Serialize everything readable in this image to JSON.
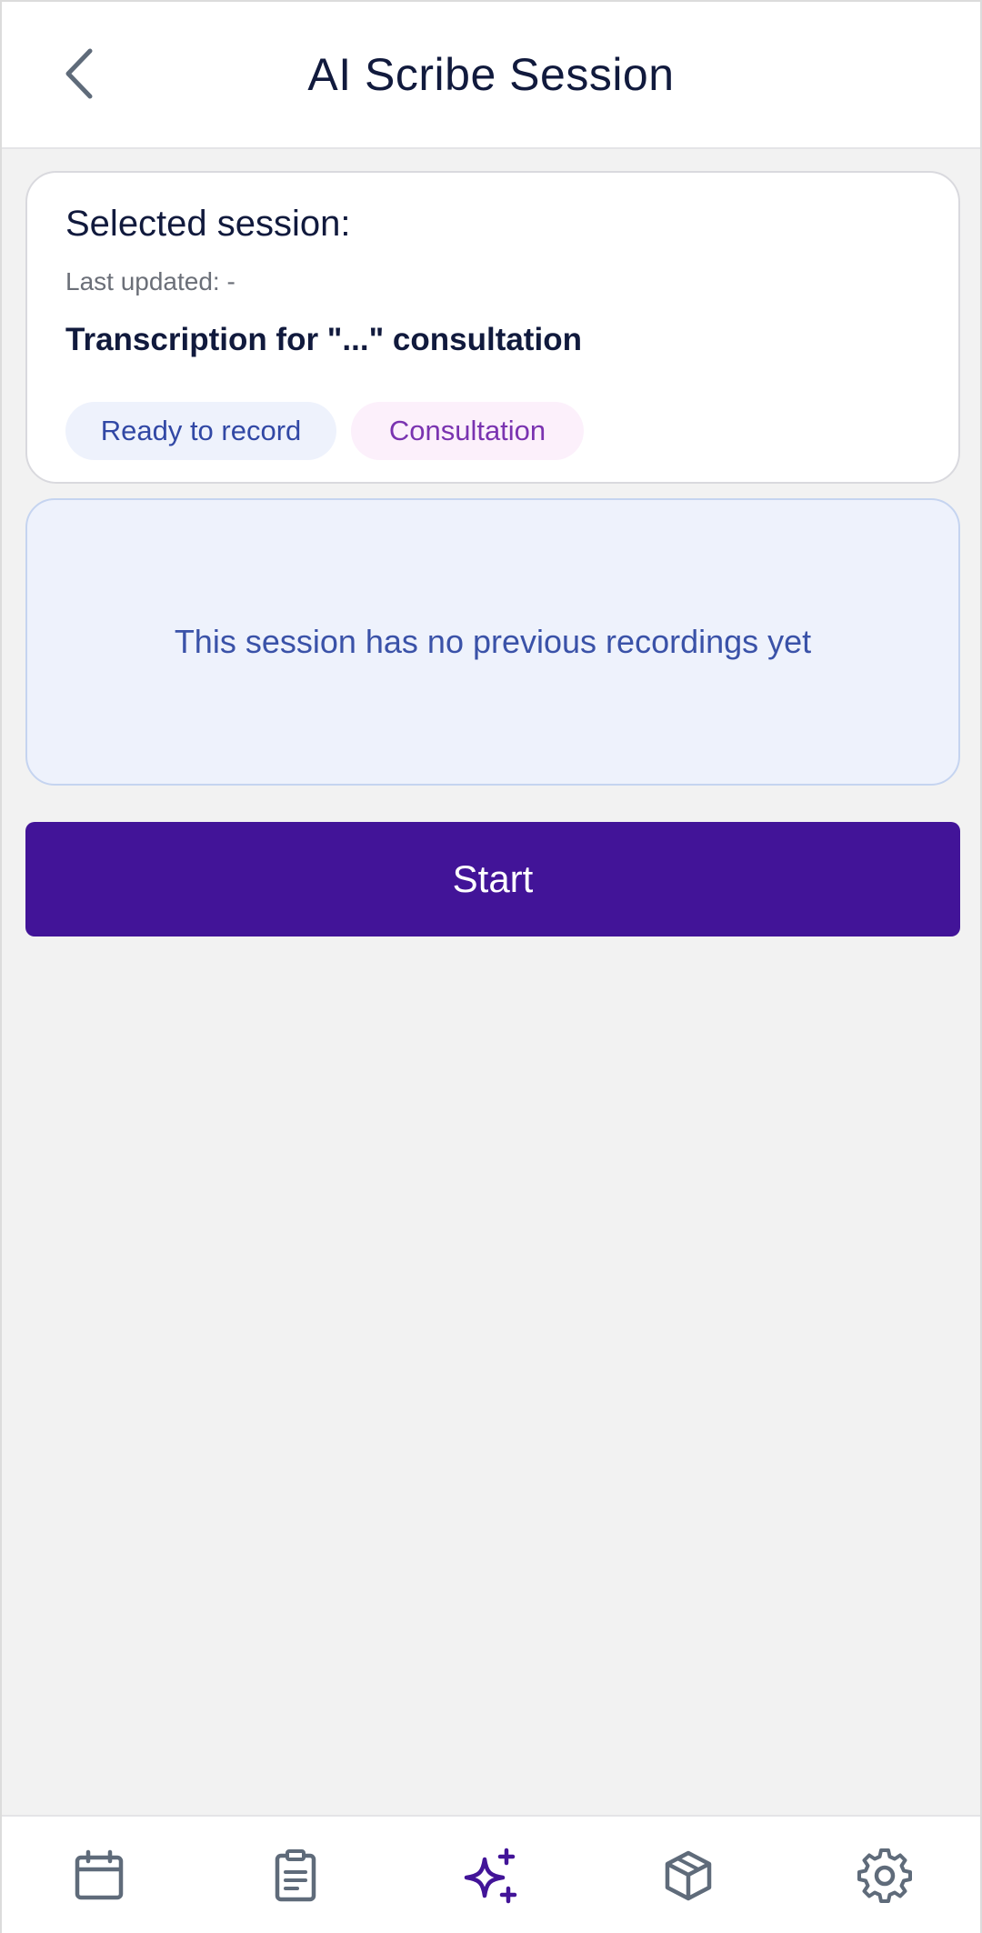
{
  "header": {
    "title": "AI Scribe Session",
    "back_icon": "chevron-left-icon"
  },
  "session": {
    "selected_label": "Selected session:",
    "last_updated": "Last updated: -",
    "title": "Transcription for \"...\" consultation",
    "status_badge": "Ready to record",
    "type_badge": "Consultation"
  },
  "recordings": {
    "empty_message": "This session has no previous recordings yet"
  },
  "actions": {
    "start_label": "Start"
  },
  "bottom_nav": {
    "items": [
      {
        "icon": "calendar-icon",
        "active": false
      },
      {
        "icon": "clipboard-icon",
        "active": false
      },
      {
        "icon": "ai-sparkles-icon",
        "active": true
      },
      {
        "icon": "package-icon",
        "active": false
      },
      {
        "icon": "gear-icon",
        "active": false
      }
    ]
  },
  "colors": {
    "primary": "#421498",
    "title_text": "#111a3d",
    "status_badge_bg": "#eef2fc",
    "status_badge_text": "#3148a5",
    "type_badge_bg": "#fcf0fb",
    "type_badge_text": "#7a33b0",
    "nav_icon": "#5f6b7a"
  }
}
